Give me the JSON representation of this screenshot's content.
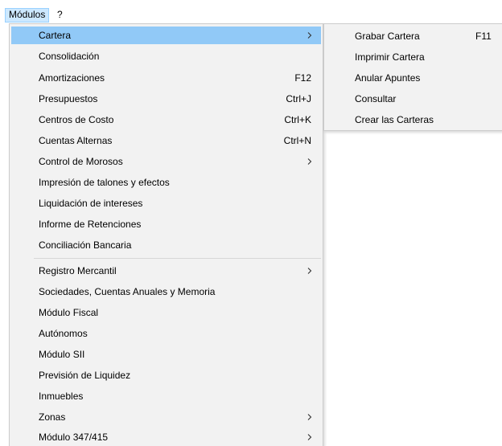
{
  "menubar": {
    "items": [
      {
        "label": "Módulos",
        "active": true
      },
      {
        "label": "?",
        "active": false
      }
    ]
  },
  "dropdown": {
    "items": [
      {
        "label": "Cartera",
        "shortcut": "",
        "submenu": true,
        "highlighted": true
      },
      {
        "label": "Consolidación",
        "shortcut": "",
        "submenu": false
      },
      {
        "label": "Amortizaciones",
        "shortcut": "F12",
        "submenu": false
      },
      {
        "label": "Presupuestos",
        "shortcut": "Ctrl+J",
        "submenu": false
      },
      {
        "label": "Centros de Costo",
        "shortcut": "Ctrl+K",
        "submenu": false
      },
      {
        "label": "Cuentas Alternas",
        "shortcut": "Ctrl+N",
        "submenu": false
      },
      {
        "label": "Control de Morosos",
        "shortcut": "",
        "submenu": true
      },
      {
        "label": "Impresión de talones y efectos",
        "shortcut": "",
        "submenu": false
      },
      {
        "label": "Liquidación de intereses",
        "shortcut": "",
        "submenu": false
      },
      {
        "label": "Informe de Retenciones",
        "shortcut": "",
        "submenu": false
      },
      {
        "label": "Conciliación Bancaria",
        "shortcut": "",
        "submenu": false
      },
      {
        "label": "Registro Mercantil",
        "shortcut": "",
        "submenu": true
      },
      {
        "label": "Sociedades, Cuentas Anuales y Memoria",
        "shortcut": "",
        "submenu": false
      },
      {
        "label": "Módulo Fiscal",
        "shortcut": "",
        "submenu": false
      },
      {
        "label": "Autónomos",
        "shortcut": "",
        "submenu": false
      },
      {
        "label": "Módulo SII",
        "shortcut": "",
        "submenu": false
      },
      {
        "label": "Previsión de Liquidez",
        "shortcut": "",
        "submenu": false
      },
      {
        "label": "Inmuebles",
        "shortcut": "",
        "submenu": false
      },
      {
        "label": "Zonas",
        "shortcut": "",
        "submenu": true
      },
      {
        "label": "Módulo 347/415",
        "shortcut": "",
        "submenu": true
      }
    ]
  },
  "submenu": {
    "items": [
      {
        "label": "Grabar Cartera",
        "shortcut": "F11"
      },
      {
        "label": "Imprimir Cartera",
        "shortcut": ""
      },
      {
        "label": "Anular Apuntes",
        "shortcut": ""
      },
      {
        "label": "Consultar",
        "shortcut": ""
      },
      {
        "label": "Crear las Carteras",
        "shortcut": ""
      }
    ]
  },
  "colors": {
    "menu_background": "#f2f2f2",
    "highlight": "#91c9f7",
    "menubar_active": "#cce8ff",
    "menubar_active_border": "#99d1ff",
    "separator": "#d7d7d7"
  },
  "icons": {
    "submenu_arrow": "chevron-right-icon"
  }
}
